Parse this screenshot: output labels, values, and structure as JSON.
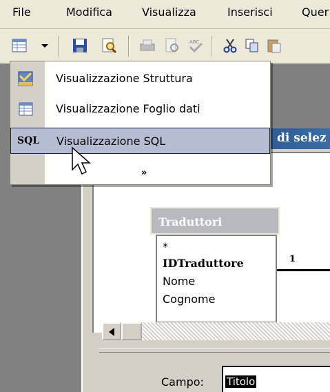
{
  "menubar": {
    "items": [
      "File",
      "Modifica",
      "Visualizza",
      "Inserisci",
      "Quer"
    ]
  },
  "toolbar": {
    "buttons": [
      "view-icon",
      "dropdown-arrow-icon",
      "save-icon",
      "search-icon",
      "print-icon",
      "print-preview-icon",
      "spelling-icon",
      "cut-icon",
      "copy-icon",
      "paste-icon"
    ]
  },
  "dropdown_menu": {
    "items": [
      {
        "label": "Visualizzazione Struttura",
        "icon": "design-view-icon"
      },
      {
        "label": "Visualizzazione Foglio dati",
        "icon": "datasheet-icon"
      },
      {
        "label": "Visualizzazione SQL",
        "icon": "sql-icon",
        "icon_text": "SQL",
        "highlighted": true
      }
    ],
    "expand_glyph": "»"
  },
  "query_window": {
    "title_fragment": "di selez"
  },
  "table": {
    "title": "Traduttori",
    "fields": [
      "*",
      "IDTraduttore",
      "Nome",
      "Cognome"
    ],
    "key_field": "IDTraduttore"
  },
  "relationship": {
    "label": "1"
  },
  "grid": {
    "row_label": "Campo:",
    "value": "Titolo"
  },
  "colors": {
    "highlight": "#b6bdd2",
    "title_bar": "#0a246a",
    "desktop": "#808080"
  }
}
